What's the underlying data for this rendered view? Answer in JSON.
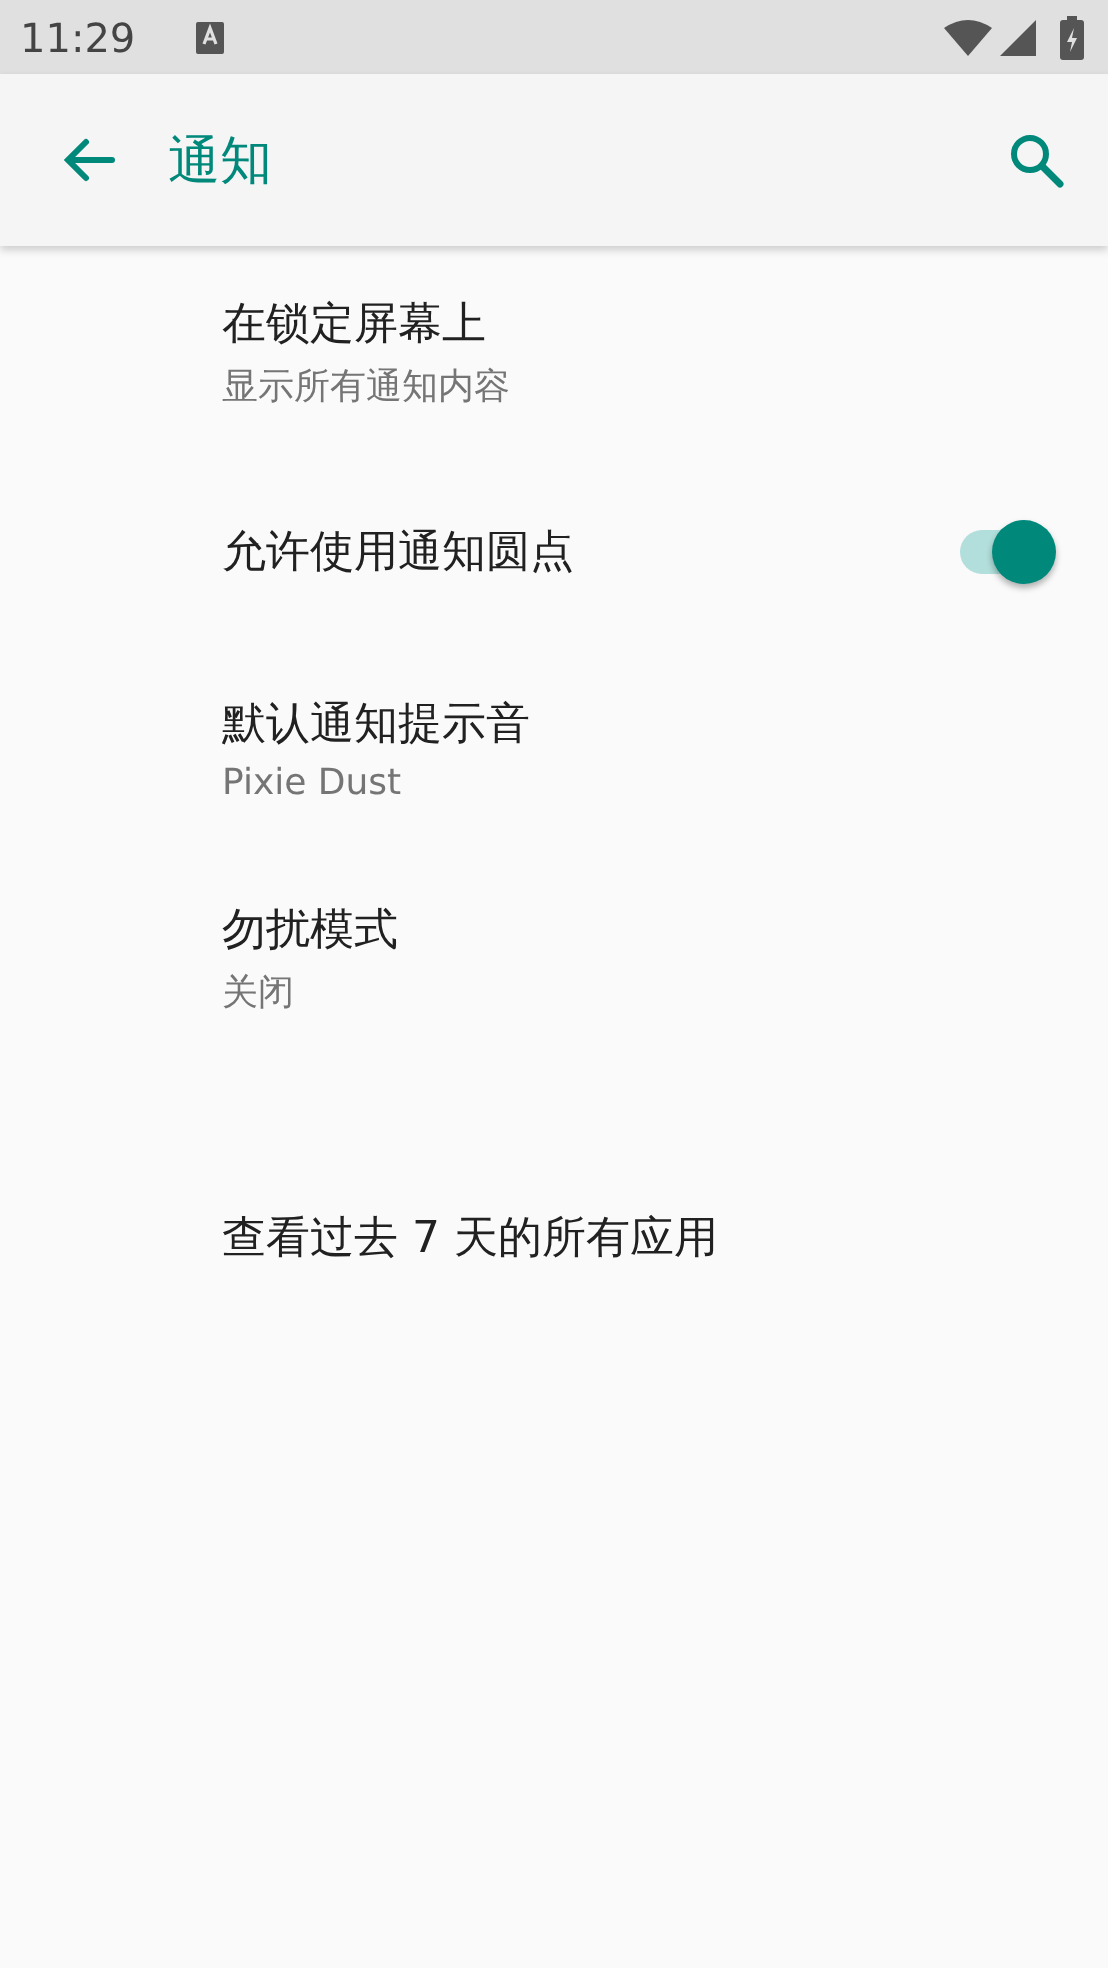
{
  "status_bar": {
    "time": "11:29"
  },
  "toolbar": {
    "title": "通知"
  },
  "settings": [
    {
      "kind": "text",
      "title": "在锁定屏幕上",
      "summary": "显示所有通知内容"
    },
    {
      "kind": "switch",
      "title": "允许使用通知圆点",
      "on": true
    },
    {
      "kind": "text",
      "title": "默认通知提示音",
      "summary": "Pixie Dust"
    },
    {
      "kind": "text",
      "title": "勿扰模式",
      "summary": "关闭"
    },
    {
      "kind": "link",
      "title": "查看过去 7 天的所有应用"
    }
  ]
}
